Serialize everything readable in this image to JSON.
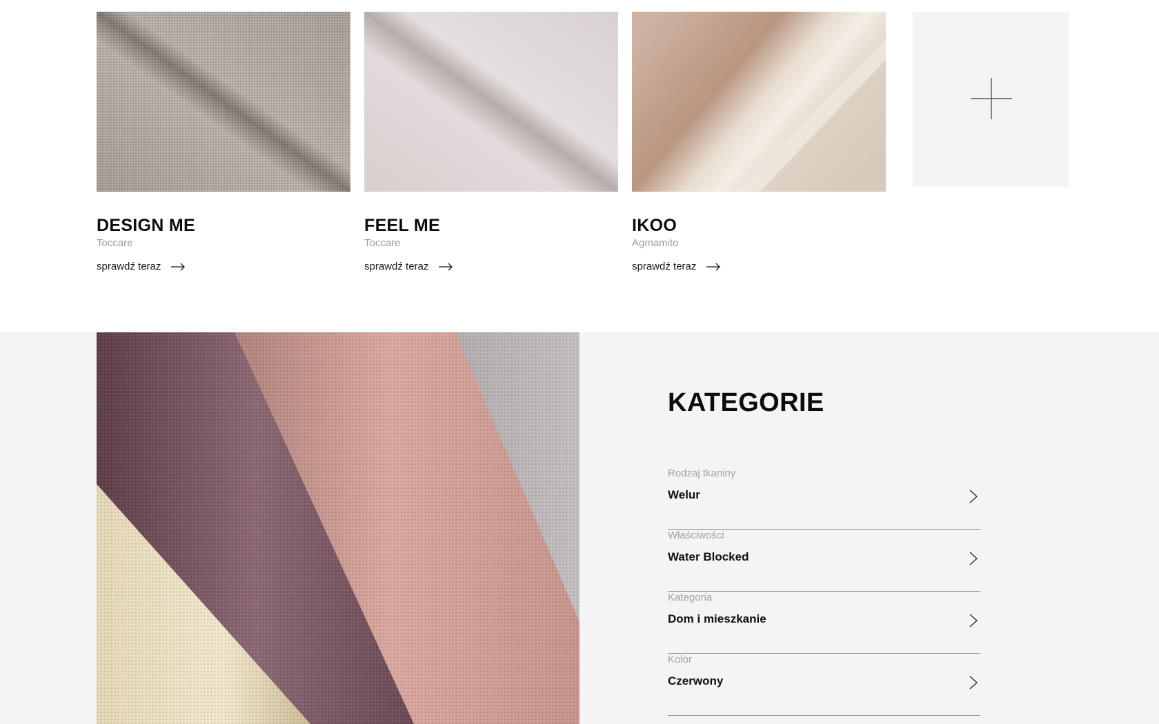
{
  "products": [
    {
      "title": "DESIGN ME",
      "brand": "Toccare",
      "link": "sprawdź teraz",
      "swatch": "grey-tweed"
    },
    {
      "title": "FEEL ME",
      "brand": "Toccare",
      "link": "sprawdź teraz",
      "swatch": "pale-lilac"
    },
    {
      "title": "IKOO",
      "brand": "Agmamito",
      "link": "sprawdź teraz",
      "swatch": "beige-velvet"
    }
  ],
  "more_tile": {
    "icon": "plus-icon"
  },
  "categories": {
    "heading": "KATEGORIE",
    "filters": [
      {
        "label": "Rodzaj tkaniny",
        "value": "Welur"
      },
      {
        "label": "Właściwości",
        "value": "Water Blocked"
      },
      {
        "label": "Kategoria",
        "value": "Dom i mieszkanie"
      },
      {
        "label": "Kolor",
        "value": "Czerwony"
      }
    ]
  },
  "colors": {
    "band_background": "#f4f4f4",
    "muted_text": "#9b9b9b",
    "divider": "#8a8a8a"
  }
}
